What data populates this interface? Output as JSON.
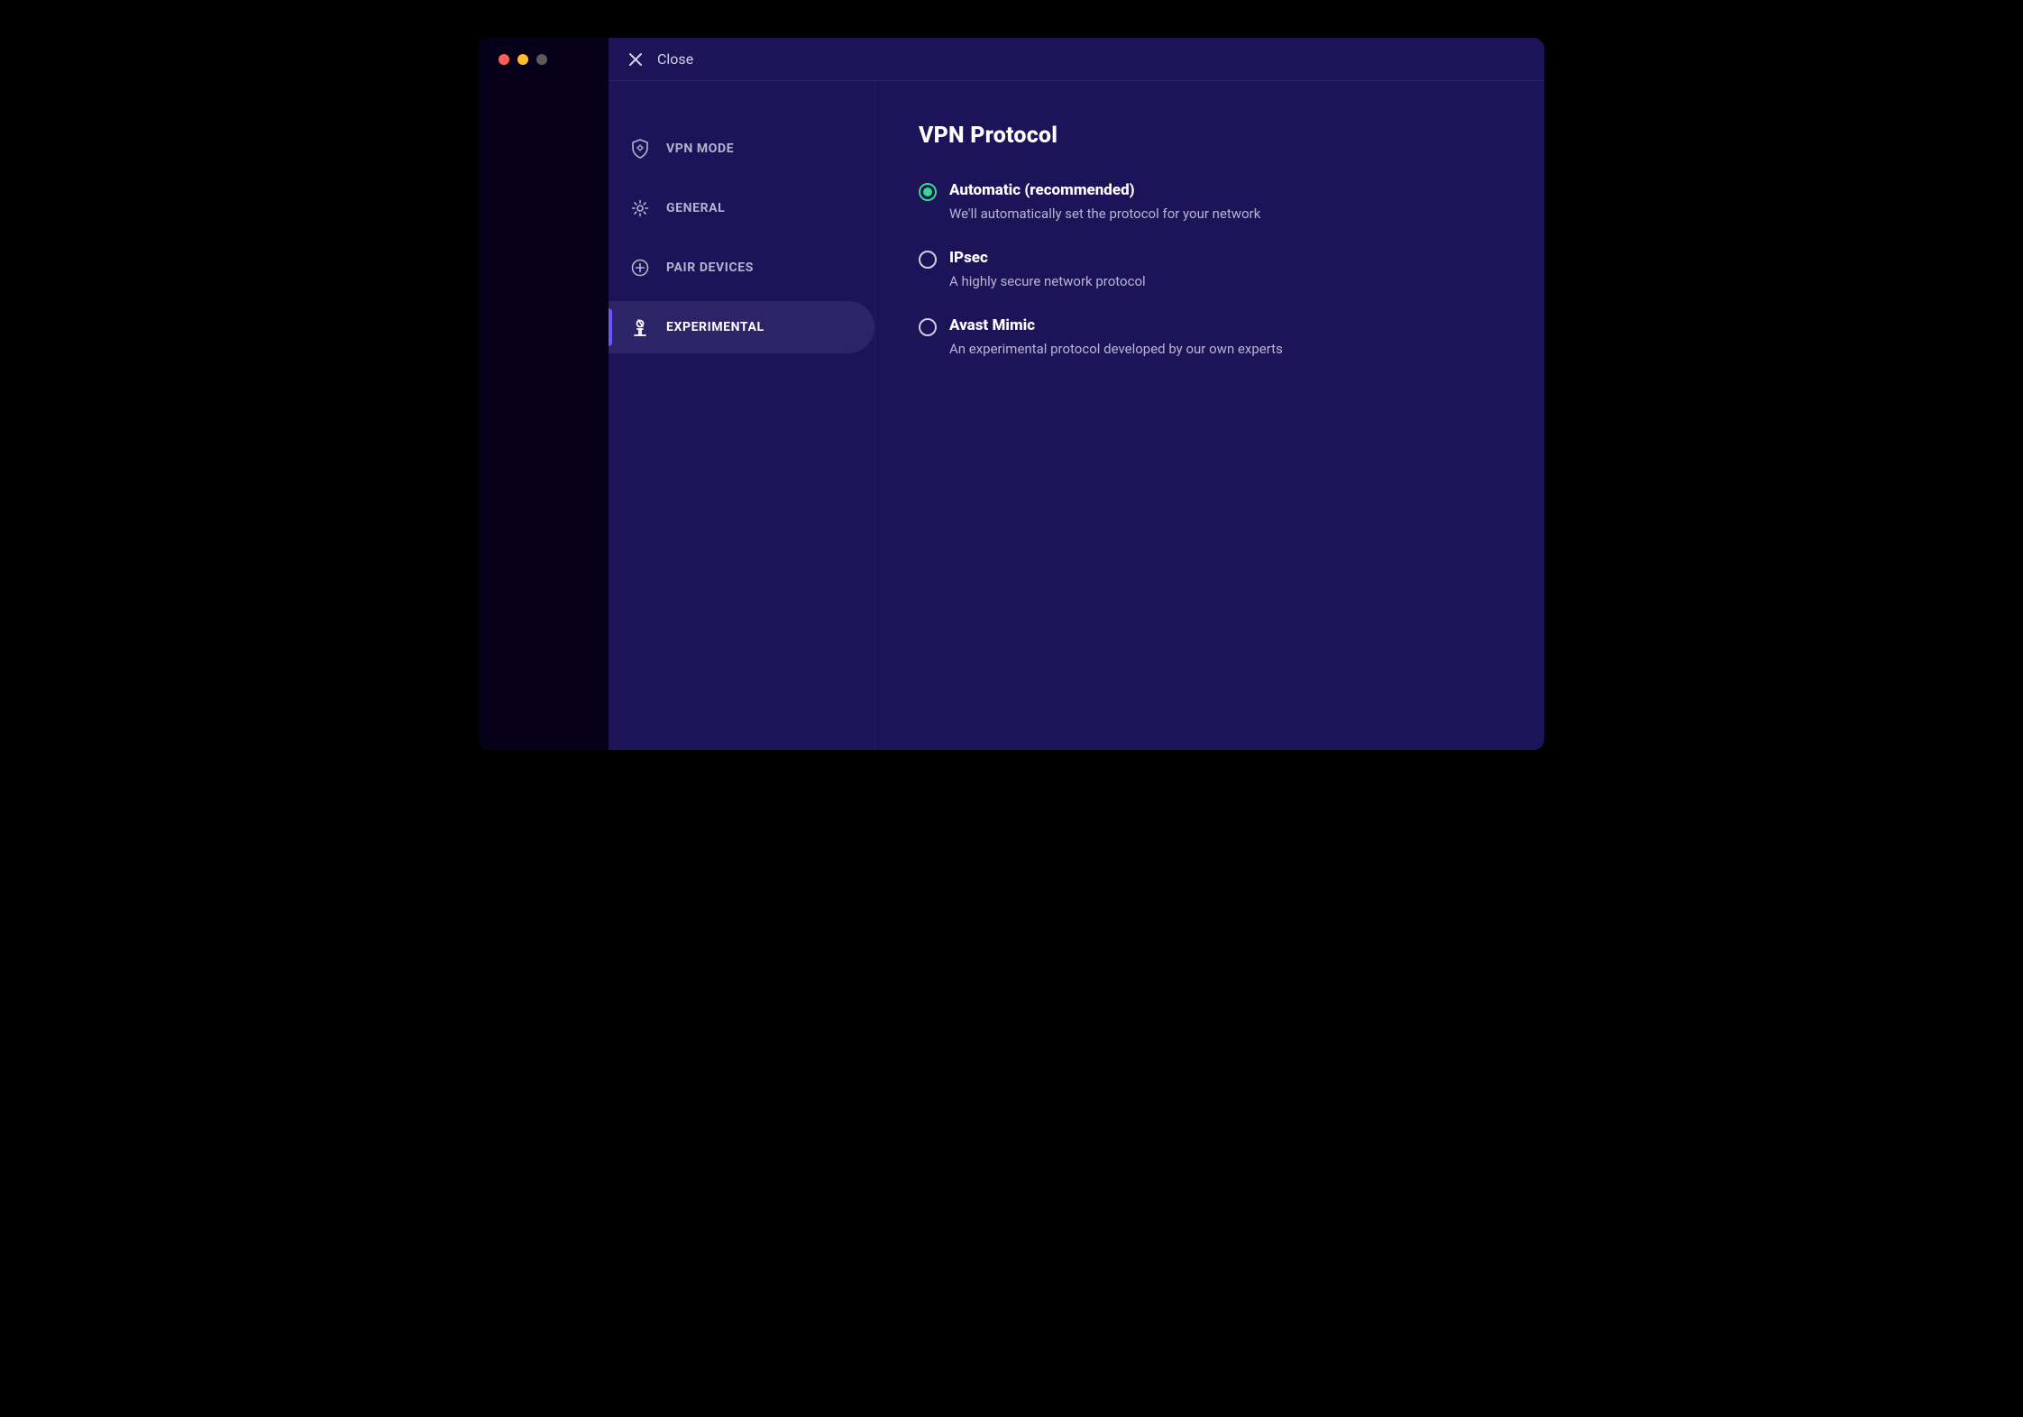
{
  "titlebar": {
    "close_label": "Close"
  },
  "sidebar": {
    "items": [
      {
        "label": "VPN MODE"
      },
      {
        "label": "GENERAL"
      },
      {
        "label": "PAIR DEVICES"
      },
      {
        "label": "EXPERIMENTAL"
      }
    ],
    "selected_index": 3
  },
  "main": {
    "title": "VPN Protocol",
    "options": [
      {
        "title": "Automatic (recommended)",
        "desc": "We'll automatically set the protocol for your network",
        "checked": true
      },
      {
        "title": "IPsec",
        "desc": "A highly secure network protocol",
        "checked": false
      },
      {
        "title": "Avast Mimic",
        "desc": "An experimental protocol developed by our own experts",
        "checked": false
      }
    ]
  }
}
